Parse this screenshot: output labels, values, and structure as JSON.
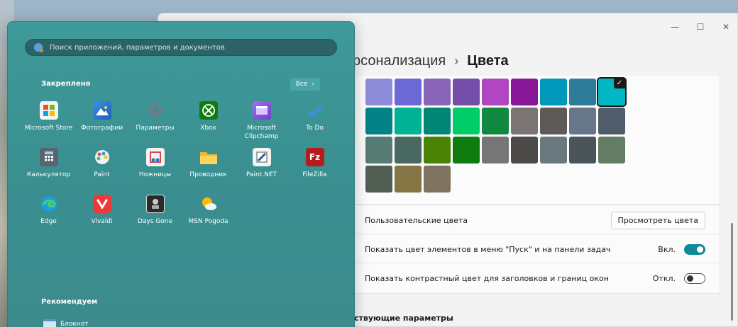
{
  "settings": {
    "breadcrumb_parent": "рсонализация",
    "breadcrumb_sep": "›",
    "breadcrumb_current": "Цвета",
    "window_controls": {
      "minimize": "—",
      "maximize": "☐",
      "close": "✕"
    },
    "swatches": [
      "#8e8cd8",
      "#6b69d6",
      "#8764b8",
      "#744da9",
      "#b146c2",
      "#881798",
      "#0099bc",
      "#2d7d9a",
      "#00b7c3",
      "#038387",
      "#00b294",
      "#018574",
      "#00cc6a",
      "#10893e",
      "#7a7574",
      "#5d5a58",
      "#68768a",
      "#515c6b",
      "#567c73",
      "#486860",
      "#498205",
      "#107c10",
      "#767676",
      "#4c4a48",
      "#69797e",
      "#4a5459",
      "#647c64",
      "#525e54",
      "#847545",
      "#7e735f"
    ],
    "selected_swatch": 8,
    "custom_colors_label": "Пользовательские цвета",
    "view_colors_button": "Просмотреть цвета",
    "show_accent_start_label": "Показать цвет элементов в меню \"Пуск\" и на панели задач",
    "show_accent_start_state": "Вкл.",
    "show_accent_titlebar_label": "Показать контрастный цвет для заголовков и границ окон",
    "show_accent_titlebar_state": "Откл.",
    "related_label": "ствующие параметры"
  },
  "start": {
    "search_placeholder": "Поиск приложений, параметров и документов",
    "pinned_title": "Закреплено",
    "all_button": "Все",
    "all_chevron": "›",
    "apps": [
      {
        "label": "Microsoft Store",
        "icon": "store-icon"
      },
      {
        "label": "Фотографии",
        "icon": "photos-icon"
      },
      {
        "label": "Параметры",
        "icon": "gear-icon"
      },
      {
        "label": "Xbox",
        "icon": "xbox-icon"
      },
      {
        "label": "Microsoft Clipchamp",
        "icon": "clipchamp-icon"
      },
      {
        "label": "To Do",
        "icon": "todo-icon"
      },
      {
        "label": "Калькулятор",
        "icon": "calculator-icon"
      },
      {
        "label": "Paint",
        "icon": "paint-icon"
      },
      {
        "label": "Ножницы",
        "icon": "snipping-icon"
      },
      {
        "label": "Проводник",
        "icon": "folder-icon"
      },
      {
        "label": "Paint.NET",
        "icon": "paintnet-icon"
      },
      {
        "label": "FileZilla",
        "icon": "filezilla-icon"
      },
      {
        "label": "Edge",
        "icon": "edge-icon"
      },
      {
        "label": "Vivaldi",
        "icon": "vivaldi-icon"
      },
      {
        "label": "Days Gone",
        "icon": "daysgone-icon"
      },
      {
        "label": "MSN Pogoda",
        "icon": "weather-icon"
      }
    ],
    "recommended_title": "Рекомендуем",
    "recommended_item": "Блокнот"
  }
}
